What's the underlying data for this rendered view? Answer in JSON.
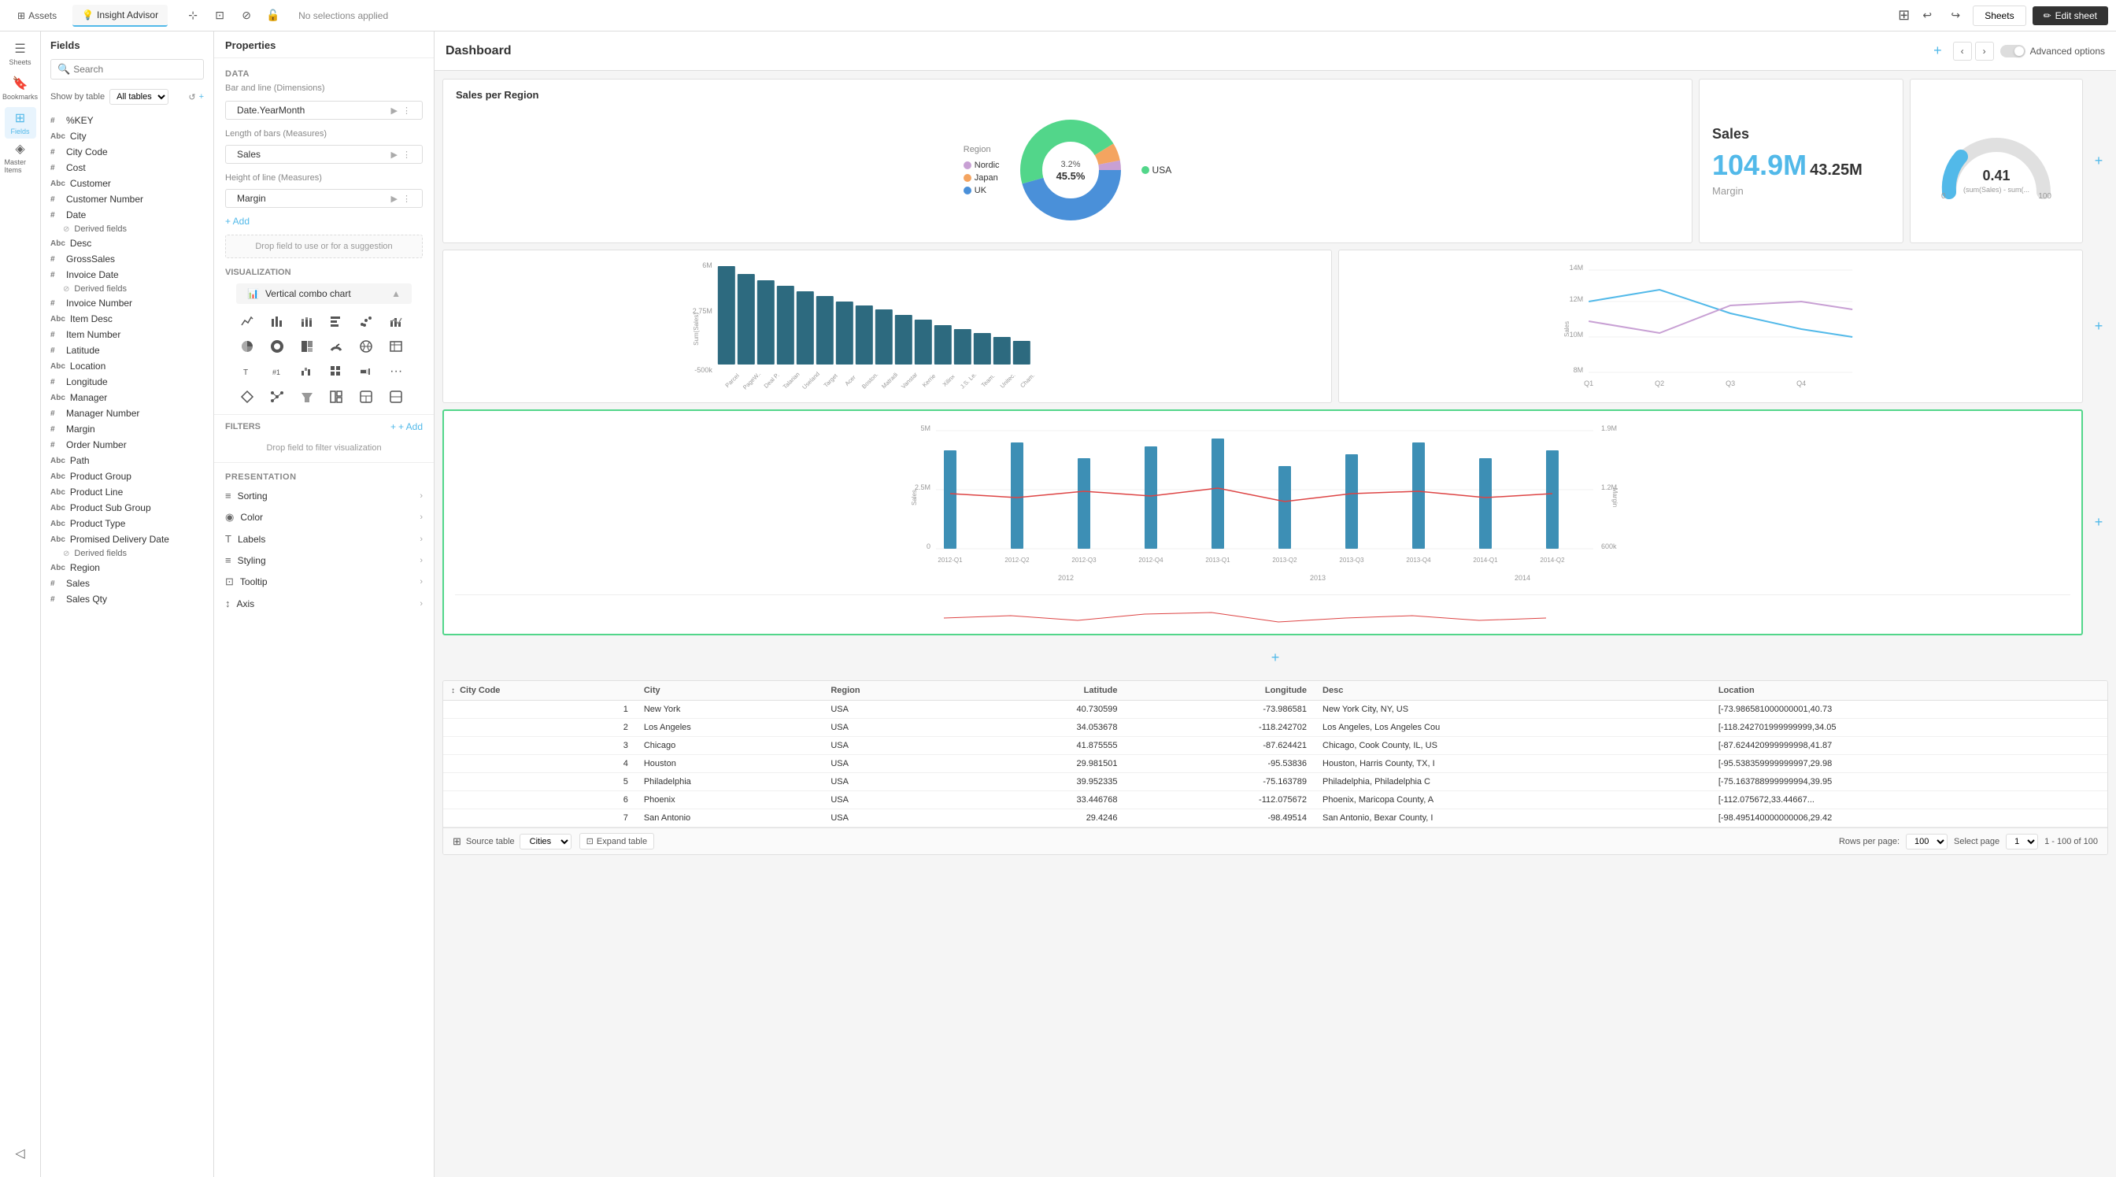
{
  "topbar": {
    "assets_label": "Assets",
    "insight_advisor_label": "Insight Advisor",
    "no_selections": "No selections applied",
    "sheets_label": "Sheets",
    "edit_sheet_label": "Edit sheet"
  },
  "nav": {
    "items": [
      {
        "id": "sheets",
        "icon": "☰",
        "label": "Sheets"
      },
      {
        "id": "bookmarks",
        "icon": "🔖",
        "label": "Bookmarks"
      },
      {
        "id": "fields",
        "icon": "⊞",
        "label": "Fields",
        "active": true
      },
      {
        "id": "master",
        "icon": "◈",
        "label": "Master Items"
      }
    ]
  },
  "fields_panel": {
    "title": "Fields",
    "search_placeholder": "Search",
    "show_by_table_label": "Show by table",
    "all_tables_option": "All tables",
    "fields": [
      {
        "type": "#",
        "name": "%KEY"
      },
      {
        "type": "Abc",
        "name": "City"
      },
      {
        "type": "#",
        "name": "City Code"
      },
      {
        "type": "#",
        "name": "Cost"
      },
      {
        "type": "Abc",
        "name": "Customer"
      },
      {
        "type": "#",
        "name": "Customer Number"
      },
      {
        "type": "#",
        "name": "Date"
      },
      {
        "type": "derived",
        "name": "Derived fields",
        "indent": true
      },
      {
        "type": "Abc",
        "name": "Desc"
      },
      {
        "type": "#",
        "name": "GrossSales"
      },
      {
        "type": "#",
        "name": "Invoice Date"
      },
      {
        "type": "derived",
        "name": "Derived fields",
        "indent": true
      },
      {
        "type": "#",
        "name": "Invoice Number"
      },
      {
        "type": "Abc",
        "name": "Item Desc"
      },
      {
        "type": "#",
        "name": "Item Number"
      },
      {
        "type": "#",
        "name": "Latitude"
      },
      {
        "type": "Abc",
        "name": "Location"
      },
      {
        "type": "#",
        "name": "Longitude"
      },
      {
        "type": "Abc",
        "name": "Manager"
      },
      {
        "type": "#",
        "name": "Manager Number"
      },
      {
        "type": "#",
        "name": "Margin"
      },
      {
        "type": "#",
        "name": "Order Number"
      },
      {
        "type": "Abc",
        "name": "Path"
      },
      {
        "type": "Abc",
        "name": "Product Group"
      },
      {
        "type": "Abc",
        "name": "Product Line"
      },
      {
        "type": "Abc",
        "name": "Product Sub Group"
      },
      {
        "type": "Abc",
        "name": "Product Type"
      },
      {
        "type": "Abc",
        "name": "Promised Delivery Date"
      },
      {
        "type": "derived",
        "name": "Derived fields",
        "indent": true
      },
      {
        "type": "Abc",
        "name": "Region"
      },
      {
        "type": "#",
        "name": "Sales"
      },
      {
        "type": "#",
        "name": "Sales Qty"
      }
    ]
  },
  "properties": {
    "title": "Properties",
    "data_section": "Data",
    "bar_line_label": "Bar and line (Dimensions)",
    "date_year_month": "Date.YearMonth",
    "length_bars_label": "Length of bars (Measures)",
    "sales_label": "Sales",
    "height_line_label": "Height of line (Measures)",
    "margin_label": "Margin",
    "add_label": "+ Add",
    "drop_hint": "Drop field to use or for a suggestion",
    "visualization_label": "Visualization",
    "viz_selected": "Vertical combo chart",
    "filters_label": "Filters",
    "add_filter_label": "+ Add",
    "drop_filter_hint": "Drop field to filter visualization",
    "presentation_label": "Presentation",
    "presentation_items": [
      {
        "icon": "≡",
        "label": "Sorting"
      },
      {
        "icon": "◉",
        "label": "Color"
      },
      {
        "icon": "T",
        "label": "Labels"
      },
      {
        "icon": "≡",
        "label": "Styling"
      },
      {
        "icon": "⊡",
        "label": "Tooltip"
      },
      {
        "icon": "↕",
        "label": "Axis"
      }
    ]
  },
  "dashboard": {
    "title": "Dashboard",
    "advanced_options": "Advanced options",
    "charts": {
      "donut": {
        "title": "Sales per Region",
        "legend_label": "Region",
        "segments": [
          {
            "label": "Nordic",
            "color": "#c8a0d4",
            "pct": 3.2
          },
          {
            "label": "Japan",
            "color": "#f4a460",
            "pct": 5.8
          },
          {
            "label": "UK",
            "color": "#6baed6",
            "pct": 45.5
          },
          {
            "label": "USA",
            "color": "#74c476",
            "pct": 45.5
          }
        ],
        "pct1": "3.2%",
        "pct2": "45.5%"
      },
      "sales": {
        "label": "Sales",
        "main_value": "104.9M",
        "secondary_value": "43.25M",
        "margin_label": "Margin"
      },
      "gauge": {
        "value": "0.41",
        "sub_label": "(sum(Sales) - sum(...",
        "min": "0",
        "max": "100"
      },
      "bar": {
        "y_labels": [
          "6M",
          "2.75M",
          "-500k"
        ],
        "y_axis_label": "Sum(Sales)",
        "companies": [
          "Parcel",
          "PageW...",
          "Deal P...",
          "Talarian",
          "Useland",
          "Target",
          "Acer",
          "Boston...",
          "Matradi",
          "Vanstar",
          "Kerrie...",
          "Xilinx",
          "J.S. Le...",
          "Team...",
          "Unitec...",
          "Cham..."
        ],
        "bar_heights": [
          95,
          88,
          82,
          78,
          75,
          70,
          65,
          62,
          58,
          55,
          50,
          45,
          42,
          38,
          35,
          30
        ]
      },
      "line": {
        "y_labels": [
          "14M",
          "12M",
          "10M",
          "8M"
        ],
        "y_axis_label": "Sales",
        "x_labels": [
          "Q1",
          "Q2",
          "Q3",
          "Q4"
        ]
      },
      "combo": {
        "y_left_labels": [
          "5M",
          "2.5M",
          "0"
        ],
        "y_right_labels": [
          "1.9M",
          "1.2M",
          "600k"
        ],
        "y_axis_label": "Sales",
        "y_axis_right_label": "Margin",
        "x_labels": [
          "2012-Q1",
          "2012-Q2",
          "2012-Q3",
          "2012-Q4",
          "2013-Q1",
          "2013-Q2",
          "2013-Q3",
          "2013-Q4",
          "2014-Q1",
          "2014-Q2"
        ],
        "year_labels": [
          "2012",
          "2013",
          "2014"
        ]
      }
    },
    "table": {
      "columns": [
        "City Code",
        "City",
        "Region",
        "Latitude",
        "Longitude",
        "Desc",
        "Location"
      ],
      "rows": [
        {
          "city_code": "1",
          "city": "New York",
          "region": "USA",
          "latitude": "40.730599",
          "longitude": "-73.986581",
          "desc": "New York City, NY, US",
          "location": "[-73.986581000000001,40.73"
        },
        {
          "city_code": "2",
          "city": "Los Angeles",
          "region": "USA",
          "latitude": "34.053678",
          "longitude": "-118.242702",
          "desc": "Los Angeles, Los Angeles Cou",
          "location": "[-118.242701999999999,34.05"
        },
        {
          "city_code": "3",
          "city": "Chicago",
          "region": "USA",
          "latitude": "41.875555",
          "longitude": "-87.624421",
          "desc": "Chicago, Cook County, IL, US",
          "location": "[-87.624420999999998,41.87"
        },
        {
          "city_code": "4",
          "city": "Houston",
          "region": "USA",
          "latitude": "29.981501",
          "longitude": "-95.53836",
          "desc": "Houston, Harris County, TX, I",
          "location": "[-95.538359999999997,29.98"
        },
        {
          "city_code": "5",
          "city": "Philadelphia",
          "region": "USA",
          "latitude": "39.952335",
          "longitude": "-75.163789",
          "desc": "Philadelphia, Philadelphia C",
          "location": "[-75.163788999999994,39.95"
        },
        {
          "city_code": "6",
          "city": "Phoenix",
          "region": "USA",
          "latitude": "33.446768",
          "longitude": "-112.075672",
          "desc": "Phoenix, Maricopa County, A",
          "location": "[-112.075672,33.44667..."
        },
        {
          "city_code": "7",
          "city": "San Antonio",
          "region": "USA",
          "latitude": "29.4246",
          "longitude": "-98.49514",
          "desc": "San Antonio, Bexar County, I",
          "location": "[-98.495140000000006,29.42"
        }
      ],
      "source_table_label": "Source table",
      "source_table_name": "Cities",
      "expand_table_label": "Expand table",
      "rows_per_page_label": "Rows per page:",
      "rows_per_page": "100",
      "select_page_label": "Select page",
      "select_page": "1",
      "pagination_label": "1 - 100 of 100"
    }
  },
  "sorting_label": "Sorting",
  "location_label": "Abc Location",
  "invoice_number_label": "Invoice Number",
  "margin_field_label": "Margin",
  "customer_number_label": "Customer Number"
}
